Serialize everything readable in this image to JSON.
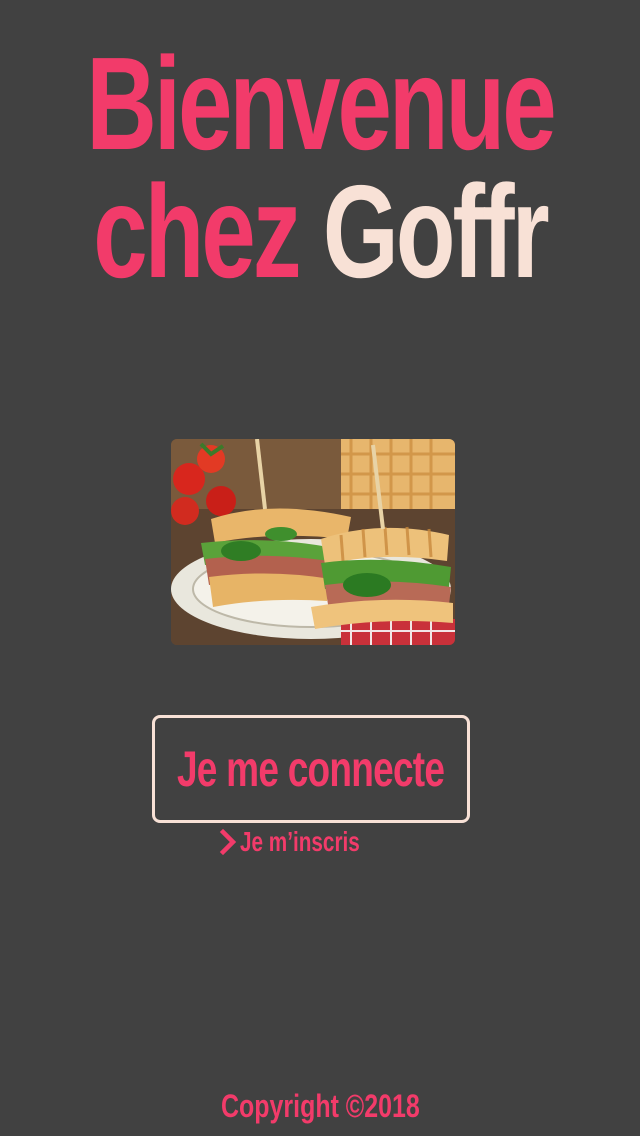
{
  "header": {
    "title_line1": "Bienvenue",
    "title_line2_accent": "chez",
    "title_line2_brand": "Goffr"
  },
  "hero": {
    "icon": "waffle-sandwich-photo"
  },
  "actions": {
    "login_label": "Je me connecte",
    "signup_label": "Je m’inscris",
    "signup_icon": "chevron-right-icon"
  },
  "footer": {
    "copyright": "Copyright ©2018"
  },
  "colors": {
    "background": "#414141",
    "accent": "#f23b6a",
    "light": "#f8e1d6"
  }
}
